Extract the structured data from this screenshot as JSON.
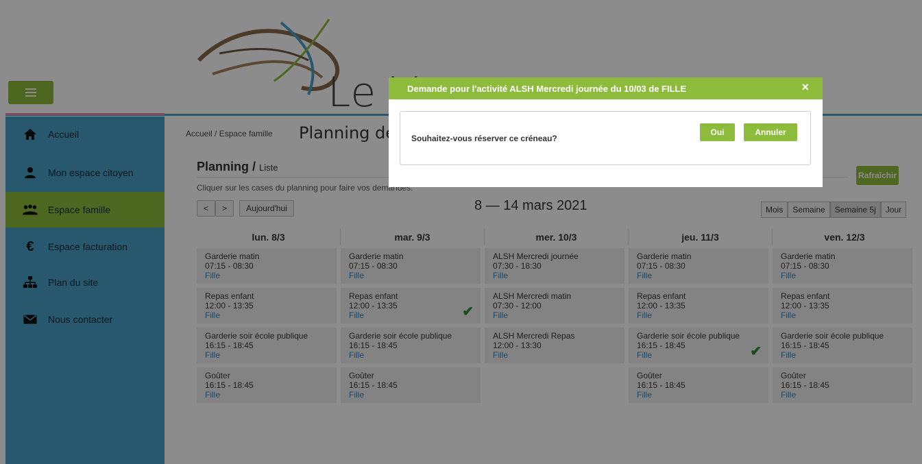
{
  "header": {
    "logo_text": "Le Verger",
    "menu_icon": "hamburger-icon"
  },
  "sidebar": {
    "items": [
      {
        "label": "Accueil",
        "icon": "home-icon"
      },
      {
        "label": "Mon espace citoyen",
        "icon": "user-icon"
      },
      {
        "label": "Espace famille",
        "icon": "family-icon",
        "active": true
      },
      {
        "label": "Espace facturation",
        "icon": "euro-icon"
      },
      {
        "label": "Plan du site",
        "icon": "sitemap-icon"
      },
      {
        "label": "Nous contacter",
        "icon": "envelope-icon"
      }
    ]
  },
  "main": {
    "breadcrumb": "Accueil / Espace famille",
    "page_title": "Planning des",
    "section_title": "Planning /",
    "section_subtitle": "Liste",
    "hint": "Cliquer sur les cases du planning pour faire vos demandes.",
    "refresh_label": "Rafraîchir",
    "prev_label": "<",
    "next_label": ">",
    "today_label": "Aujourd'hui",
    "week_range": "8 — 14 mars 2021",
    "views": [
      "Mois",
      "Semaine",
      "Semaine 5j",
      "Jour"
    ],
    "active_view": "Semaine 5j"
  },
  "days": [
    {
      "head": "lun. 8/3",
      "slots": [
        {
          "title": "Garderie matin",
          "time": "07:15 - 08:30",
          "who": "Fille"
        },
        {
          "title": "Repas enfant",
          "time": "12:00 - 13:35",
          "who": "Fille"
        },
        {
          "title": "Garderie soir école publique",
          "time": "16:15 - 18:45",
          "who": "Fille"
        },
        {
          "title": "Goûter",
          "time": "16:15 - 18:45",
          "who": "Fille"
        }
      ]
    },
    {
      "head": "mar. 9/3",
      "slots": [
        {
          "title": "Garderie matin",
          "time": "07:15 - 08:30",
          "who": "Fille"
        },
        {
          "title": "Repas enfant",
          "time": "12:00 - 13:35",
          "who": "Fille",
          "checked": true
        },
        {
          "title": "Garderie soir école publique",
          "time": "16:15 - 18:45",
          "who": "Fille"
        },
        {
          "title": "Goûter",
          "time": "16:15 - 18:45",
          "who": "Fille"
        }
      ]
    },
    {
      "head": "mer. 10/3",
      "slots": [
        {
          "title": "ALSH Mercredi journée",
          "time": "07:30 - 18:30",
          "who": "Fille"
        },
        {
          "title": "ALSH Mercredi matin",
          "time": "07:30 - 12:00",
          "who": "Fille"
        },
        {
          "title": "ALSH Mercredi Repas",
          "time": "12:00 - 13:30",
          "who": "Fille"
        }
      ]
    },
    {
      "head": "jeu. 11/3",
      "slots": [
        {
          "title": "Garderie matin",
          "time": "07:15 - 08:30",
          "who": "Fille"
        },
        {
          "title": "Repas enfant",
          "time": "12:00 - 13:35",
          "who": "Fille"
        },
        {
          "title": "Garderie soir école publique",
          "time": "16:15 - 18:45",
          "who": "Fille",
          "checked": true
        },
        {
          "title": "Goûter",
          "time": "16:15 - 18:45",
          "who": "Fille"
        }
      ]
    },
    {
      "head": "ven. 12/3",
      "slots": [
        {
          "title": "Garderie matin",
          "time": "07:15 - 08:30",
          "who": "Fille"
        },
        {
          "title": "Repas enfant",
          "time": "12:00 - 13:35",
          "who": "Fille"
        },
        {
          "title": "Garderie soir école publique",
          "time": "16:15 - 18:45",
          "who": "Fille"
        },
        {
          "title": "Goûter",
          "time": "16:15 - 18:45",
          "who": "Fille"
        }
      ]
    }
  ],
  "modal": {
    "title": "Demande pour l'activité ALSH Mercredi journée du 10/03 de FILLE",
    "close": "×",
    "question": "Souhaitez-vous réserver ce créneau?",
    "yes_label": "Oui",
    "no_label": "Annuler"
  },
  "colors": {
    "accent_green": "#8dbb3b",
    "sidebar_blue": "#4aa0c8",
    "link_blue": "#2f86c7",
    "check_green": "#2e8b3a"
  }
}
